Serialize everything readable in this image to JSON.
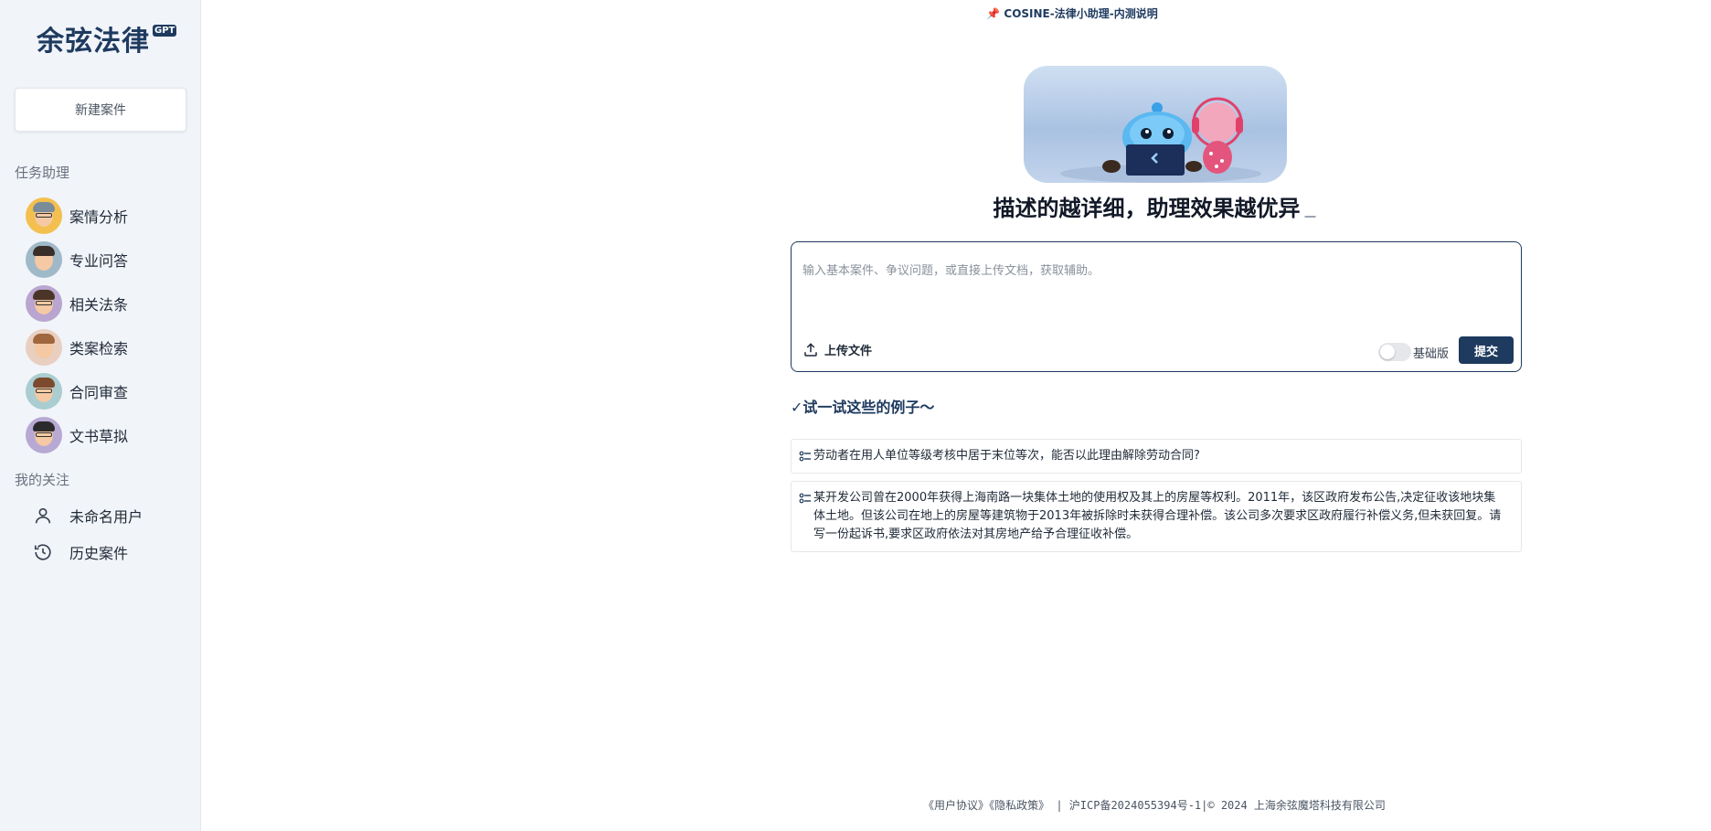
{
  "sidebar": {
    "logo": {
      "text": "余弦法律",
      "badge": "GPT"
    },
    "new_case_label": "新建案件",
    "task_section_title": "任务助理",
    "tasks": [
      {
        "label": "案情分析",
        "avatar": "avatar-cartoon-man-glasses"
      },
      {
        "label": "专业问答",
        "avatar": "avatar-cartoon-man"
      },
      {
        "label": "相关法条",
        "avatar": "avatar-cartoon-woman-glasses"
      },
      {
        "label": "类案检索",
        "avatar": "avatar-cartoon-woman"
      },
      {
        "label": "合同审查",
        "avatar": "avatar-cartoon-woman-glasses"
      },
      {
        "label": "文书草拟",
        "avatar": "avatar-cartoon-man-glasses"
      }
    ],
    "follow_section_title": "我的关注",
    "follow_items": [
      {
        "label": "未命名用户",
        "icon": "user-icon"
      },
      {
        "label": "历史案件",
        "icon": "history-icon"
      }
    ]
  },
  "main": {
    "notice": "📌 COSINE-法律小助理-内测说明",
    "hero_image": "robot-mascots-illustration",
    "headline": "描述的越详细，助理效果越优异",
    "input": {
      "value": "",
      "placeholder": "输入基本案件、争议问题，或直接上传文档，获取辅助。"
    },
    "upload_label": "上传文件",
    "toggle_label": "基础版",
    "toggle_on": false,
    "submit_label": "提交",
    "examples_title": "✓试一试这些的例子～",
    "examples": [
      "劳动者在用人单位等级考核中居于末位等次，能否以此理由解除劳动合同?",
      "某开发公司曾在2000年获得上海南路一块集体土地的使用权及其上的房屋等权利。2011年，该区政府发布公告,决定征收该地块集体土地。但该公司在地上的房屋等建筑物于2013年被拆除时未获得合理补偿。该公司多次要求区政府履行补偿义务,但未获回复。请写一份起诉书,要求区政府依法对其房地产给予合理征收补偿。"
    ]
  },
  "footer": {
    "user_agreement": "《用户协议》",
    "privacy_policy": "《隐私政策》",
    "icp_text": "| 沪ICP备2024055394号-1|© 2024 上海余弦魔塔科技有限公司"
  },
  "colors": {
    "brand": "#1e3a5f",
    "sidebar_bg": "#f1f4f9"
  }
}
